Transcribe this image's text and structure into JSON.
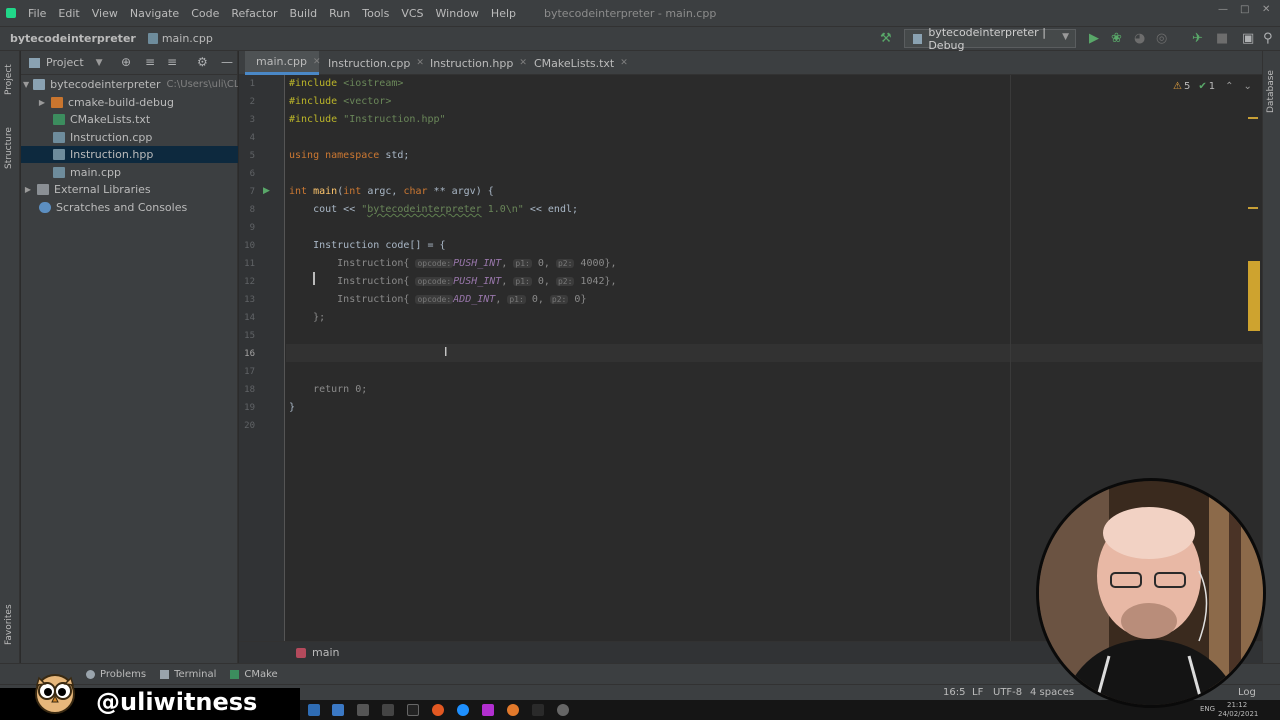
{
  "menu": {
    "items": [
      "File",
      "Edit",
      "View",
      "Navigate",
      "Code",
      "Refactor",
      "Build",
      "Run",
      "Tools",
      "VCS",
      "Window",
      "Help"
    ],
    "window_title": "bytecodeinterpreter - main.cpp"
  },
  "navbar": {
    "project": "bytecodeinterpreter",
    "file": "main.cpp",
    "run_config": "bytecodeinterpreter | Debug"
  },
  "left_stripe": {
    "project": "Project",
    "structure": "Structure",
    "favorites": "Favorites"
  },
  "right_stripe": {
    "database": "Database"
  },
  "project_panel": {
    "title": "Project",
    "root": "bytecodeinterpreter",
    "root_path": "C:\\Users\\uli\\CLionPr",
    "items": [
      {
        "label": "cmake-build-debug"
      },
      {
        "label": "CMakeLists.txt"
      },
      {
        "label": "Instruction.cpp"
      },
      {
        "label": "Instruction.hpp"
      },
      {
        "label": "main.cpp"
      }
    ],
    "external": "External Libraries",
    "scratches": "Scratches and Consoles"
  },
  "tabs": [
    "main.cpp",
    "Instruction.cpp",
    "Instruction.hpp",
    "CMakeLists.txt"
  ],
  "editor": {
    "line_numbers": [
      "1",
      "2",
      "3",
      "4",
      "5",
      "6",
      "7",
      "8",
      "9",
      "10",
      "11",
      "12",
      "13",
      "14",
      "15",
      "16",
      "17",
      "18",
      "19",
      "20"
    ],
    "code": {
      "l1a": "#include ",
      "l1b": "<iostream>",
      "l2a": "#include ",
      "l2b": "<vector>",
      "l3a": "#include ",
      "l3b": "\"Instruction.hpp\"",
      "l5a": "using namespace ",
      "l5b": "std;",
      "l7a": "int ",
      "l7b": "main",
      "l7c": "(",
      "l7d": "int ",
      "l7e": "argc, ",
      "l7f": "char ",
      "l7g": "** argv) {",
      "l8a": "    cout << ",
      "l8b": "\"",
      "l8c": "bytecodeinterpreter",
      "l8d": " 1.0\\n\"",
      "l8e": " << endl;",
      "l10a": "    Instruction code[] = {",
      "row_prefix": "        Instruction{ ",
      "hint_opcode": "opcode:",
      "hint_p1": "p1:",
      "hint_p2": "p2:",
      "l11_op": "PUSH_INT",
      "l11_p1": "0",
      "l11_p2": "4000",
      "l12_op": "PUSH_INT",
      "l12_p1": "0",
      "l12_p2": "1042",
      "l13_op": "ADD_INT",
      "l13_p1": "0",
      "l13_p2": "0",
      "l14a": "    };",
      "l18a": "    return ",
      "l18b": "0",
      "l18c": ";",
      "l19a": "}"
    },
    "inspections": {
      "warnings": "5",
      "ok": "1"
    },
    "breadcrumb": "main"
  },
  "bottom_tools": {
    "problems": "Problems",
    "terminal": "Terminal",
    "cmake": "CMake"
  },
  "status": {
    "position": "16:5",
    "line_sep": "LF",
    "encoding": "UTF-8",
    "indent": "4 spaces",
    "log": "Log"
  },
  "overlay": {
    "handle": "@uliwitness"
  },
  "taskbar": {
    "lang": "ENG",
    "time": "21:12",
    "date": "24/02/2021"
  },
  "colors": {
    "accent": "#4a88c7",
    "run_green": "#59a869",
    "keyword": "#cc7832",
    "string": "#6a8759",
    "number": "#6897bb"
  }
}
